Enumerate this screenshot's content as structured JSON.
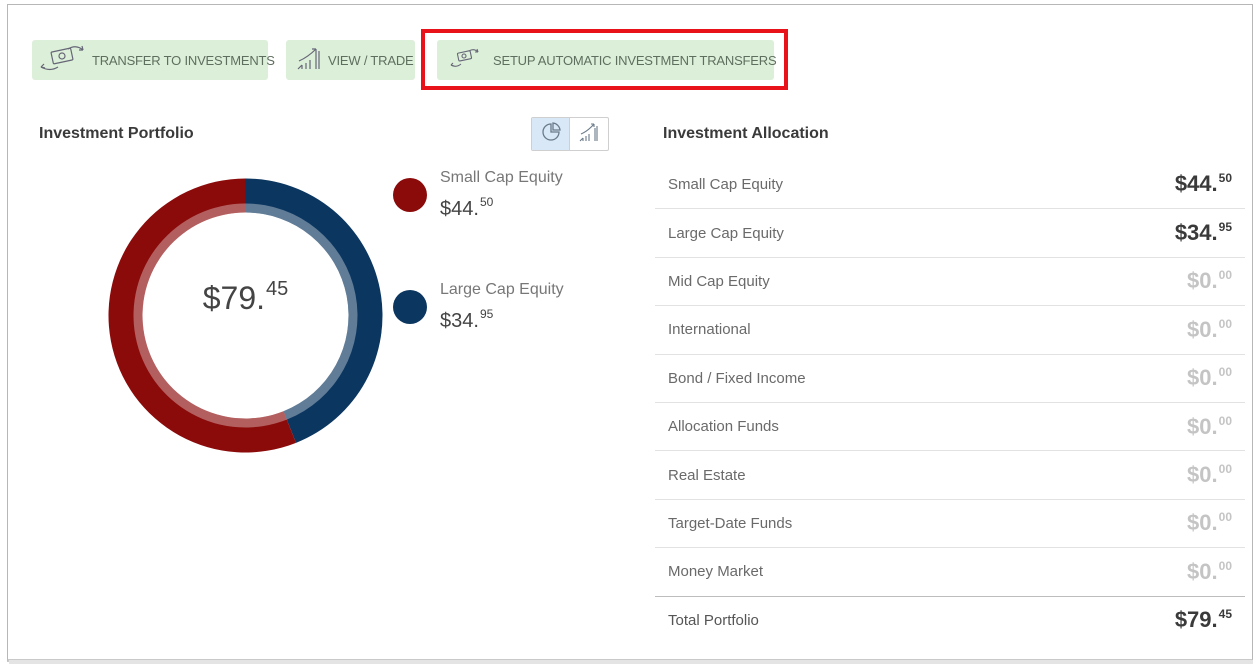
{
  "toolbar": {
    "transfer_label": "TRANSFER TO INVESTMENTS",
    "view_label": "VIEW / TRADE",
    "setup_label": "SETUP AUTOMATIC INVESTMENT TRANSFERS",
    "button_bg": "#dcefd8",
    "highlight_color": "#e8121b"
  },
  "portfolio": {
    "title": "Investment Portfolio",
    "total_whole": "$79.",
    "total_cents": "45",
    "view_toggle": [
      "pie-chart-icon",
      "growth-chart-icon"
    ],
    "active_view": "pie-chart-icon",
    "legend": [
      {
        "name": "Small Cap Equity",
        "whole": "$44.",
        "cents": "50",
        "color": "#8b0a0a"
      },
      {
        "name": "Large Cap Equity",
        "whole": "$34.",
        "cents": "95",
        "color": "#0b3660"
      }
    ]
  },
  "chart_data": {
    "type": "pie",
    "categories": [
      "Small Cap Equity",
      "Large Cap Equity"
    ],
    "values": [
      44.5,
      34.95
    ],
    "colors": [
      "#8b0a0a",
      "#0b3660"
    ]
  },
  "allocation": {
    "title": "Investment Allocation",
    "rows": [
      {
        "name": "Small Cap Equity",
        "whole": "$44.",
        "cents": "50",
        "color": "#3a3a3a"
      },
      {
        "name": "Large Cap Equity",
        "whole": "$34.",
        "cents": "95",
        "color": "#3a3a3a"
      },
      {
        "name": "Mid Cap Equity",
        "whole": "$0.",
        "cents": "00",
        "color": "#c4c4c4"
      },
      {
        "name": "International",
        "whole": "$0.",
        "cents": "00",
        "color": "#c4c4c4"
      },
      {
        "name": "Bond / Fixed Income",
        "whole": "$0.",
        "cents": "00",
        "color": "#c4c4c4"
      },
      {
        "name": "Allocation Funds",
        "whole": "$0.",
        "cents": "00",
        "color": "#c4c4c4"
      },
      {
        "name": "Real Estate",
        "whole": "$0.",
        "cents": "00",
        "color": "#c4c4c4"
      },
      {
        "name": "Target-Date Funds",
        "whole": "$0.",
        "cents": "00",
        "color": "#c4c4c4"
      },
      {
        "name": "Money Market",
        "whole": "$0.",
        "cents": "00",
        "color": "#c4c4c4"
      }
    ],
    "total": {
      "name": "Total Portfolio",
      "whole": "$79.",
      "cents": "45",
      "color": "#3a3a3a"
    }
  }
}
